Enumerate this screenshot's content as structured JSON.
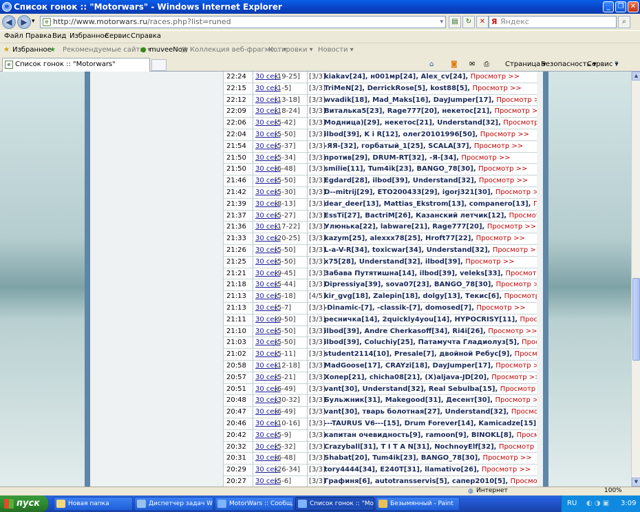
{
  "window": {
    "title": "Список гонок :: \"Motorwars\" - Windows Internet Explorer"
  },
  "address": {
    "url_host": "http://www.motorwars.ru",
    "url_path": "/races.php?list=runed",
    "search_placeholder": "Яндекс",
    "search_logo": "Я"
  },
  "menu": [
    "Файл",
    "Правка",
    "Вид",
    "Избранное",
    "Сервис",
    "Справка"
  ],
  "favbar": {
    "favorites": "Избранное",
    "items": [
      "Рекомендуемые сайты ▾",
      "muveeNow",
      "Коллекция веб-фрагме... ▾",
      "Котировки ▾",
      "Новости ▾"
    ]
  },
  "tab": {
    "label": "Список гонок :: \"Motorwars\""
  },
  "commandbar": [
    "Страница ▾",
    "Безопасность ▾",
    "Сервис ▾"
  ],
  "races": [
    {
      "time": "22:24",
      "link": "30 сек.",
      "pos": "[19-25]",
      "info": "[3/3]",
      "players": "kiakav[24], н001мр[24], Alex_cv[24],",
      "view": "Просмотр >>"
    },
    {
      "time": "22:15",
      "link": "30 сек.",
      "pos": "[1-5]",
      "info": "[3/3]",
      "players": "TriMeN[2], DerrickRose[5], kost88[5],",
      "view": "Просмотр >>"
    },
    {
      "time": "22:12",
      "link": "30 сек.",
      "pos": "[13-18]",
      "info": "[3/3]",
      "players": "wvadik[18], Mad_Maks[16], DayJumper[17],",
      "view": "Просмотр >>"
    },
    {
      "time": "22:09",
      "link": "30 сек.",
      "pos": "[18-24]",
      "info": "[3/3]",
      "players": "Виталька5[23], Rage777[20], некетос[21],",
      "view": "Просмотр >>"
    },
    {
      "time": "22:06",
      "link": "30 сек.",
      "pos": "[5-42]",
      "info": "[3/3]",
      "players": "Модница)[29], некетос[21], Understand[32],",
      "view": "Просмотр >>"
    },
    {
      "time": "22:04",
      "link": "30 сек.",
      "pos": "[5-50]",
      "info": "[3/3]",
      "players": "ilbod[39], K i R[12], олег20101996[50],",
      "view": "Просмотр >>"
    },
    {
      "time": "21:54",
      "link": "30 сек.",
      "pos": "[5-37]",
      "info": "[3/3]",
      "players": "-ЯЯ-[32], горбатый_1[25], SCALA[37],",
      "view": "Просмотр >>"
    },
    {
      "time": "21:50",
      "link": "30 сек.",
      "pos": "[5-34]",
      "info": "[3/3]",
      "players": "против[29], DRUM-RT[32], -Я-[34],",
      "view": "Просмотр >>"
    },
    {
      "time": "21:50",
      "link": "30 сек.",
      "pos": "[6-48]",
      "info": "[3/3]",
      "players": "smilie[11], Tum4ik[23], BANGO_78[30],",
      "view": "Просмотр >>"
    },
    {
      "time": "21:46",
      "link": "30 сек.",
      "pos": "[5-50]",
      "info": "[3/3]",
      "players": "Egdard[28], ilbod[39], Understand[32],",
      "view": "Просмотр >>"
    },
    {
      "time": "21:42",
      "link": "30 сек.",
      "pos": "[5-30]",
      "info": "[3/3]",
      "players": "D--mitrij[29], ETO200433[29], igorj321[30],",
      "view": "Просмотр >>"
    },
    {
      "time": "21:39",
      "link": "30 сек.",
      "pos": "[8-13]",
      "info": "[3/3]",
      "players": "dear_deer[13], Mattias_Ekstrom[13], companero[13],",
      "view": "Просмотр >>"
    },
    {
      "time": "21:37",
      "link": "30 сек.",
      "pos": "[5-27]",
      "info": "[3/3]",
      "players": "EssTi[27], BactriM[26], Казанский летчик[12],",
      "view": "Просмотр >>"
    },
    {
      "time": "21:36",
      "link": "30 сек.",
      "pos": "[17-22]",
      "info": "[3/3]",
      "players": "Улюнька[22], labware[21], Rage777[20],",
      "view": "Просмотр >>"
    },
    {
      "time": "21:33",
      "link": "30 сек.",
      "pos": "[20-25]",
      "info": "[3/3]",
      "players": "kazym[25], alexxx78[25], Hroft77[22],",
      "view": "Просмотр >>"
    },
    {
      "time": "21:26",
      "link": "30 сек.",
      "pos": "[5-50]",
      "info": "[3/3]",
      "players": "L-a-V-R[34], toxicwar[34], Understand[32],",
      "view": "Просмотр >>"
    },
    {
      "time": "21:25",
      "link": "30 сек.",
      "pos": "[5-50]",
      "info": "[3/3]",
      "players": "x75[28], Understand[32], ilbod[39],",
      "view": "Просмотр >>"
    },
    {
      "time": "21:21",
      "link": "30 сек.",
      "pos": "[9-45]",
      "info": "[3/3]",
      "players": "Забава Путятишна[14], ilbod[39], veleks[33],",
      "view": "Просмотр >>"
    },
    {
      "time": "21:18",
      "link": "30 сек.",
      "pos": "[5-44]",
      "info": "[3/3]",
      "players": "Dipressiya[39], sova07[23], BANGO_78[30],",
      "view": "Просмотр >>"
    },
    {
      "time": "21:13",
      "link": "30 сек.",
      "pos": "[5-18]",
      "info": "[4/5]",
      "players": "kir_gvg[18], Zalepin[18], dolgy[13], Текис[6],",
      "view": "Просмотр >>"
    },
    {
      "time": "21:13",
      "link": "30 сек.",
      "pos": "[5-7]",
      "info": "[3/3]",
      "players": "-Dinamic-[7], -classik-[7], domosed[7],",
      "view": "Просмотр >>"
    },
    {
      "time": "21:11",
      "link": "30 сек.",
      "pos": "[9-50]",
      "info": "[3/3]",
      "players": "ресничка[14], 2quickly4you[14], HYPOCRISY[11],",
      "view": "Просмотр >>"
    },
    {
      "time": "21:10",
      "link": "30 сек.",
      "pos": "[5-50]",
      "info": "[3/3]",
      "players": "ilbod[39], Andre Cherkasoff[34], Ri4i[26],",
      "view": "Просмотр >>"
    },
    {
      "time": "21:03",
      "link": "30 сек.",
      "pos": "[5-50]",
      "info": "[3/3]",
      "players": "ilbod[39], Coluchiy[25], Патамучта Гладиолуз[5],",
      "view": "Просмотр >>"
    },
    {
      "time": "21:02",
      "link": "30 сек.",
      "pos": "[5-11]",
      "info": "[3/3]",
      "players": "student2114[10], Presale[7], двойной Ребус[9],",
      "view": "Просмотр >>"
    },
    {
      "time": "20:58",
      "link": "30 сек.",
      "pos": "[12-18]",
      "info": "[3/3]",
      "players": "MadGoose[17], CRAYzi[18], DayJumper[17],",
      "view": "Просмотр >>"
    },
    {
      "time": "20:57",
      "link": "30 сек.",
      "pos": "[5-21]",
      "info": "[3/3]",
      "players": "Хопер[21], chicha08[21], (X)aljava-JD[20],",
      "view": "Просмотр >>"
    },
    {
      "time": "20:51",
      "link": "30 сек.",
      "pos": "[6-49]",
      "info": "[3/3]",
      "players": "vant[30], Understand[32], Real Sebulba[15],",
      "view": "Просмотр >>"
    },
    {
      "time": "20:48",
      "link": "30 сек.",
      "pos": "[30-32]",
      "info": "[3/3]",
      "players": "Бульжник[31], Makegood[31], Десент[30],",
      "view": "Просмотр >>"
    },
    {
      "time": "20:47",
      "link": "30 сек.",
      "pos": "[6-49]",
      "info": "[3/3]",
      "players": "vant[30], тварь болотная[27], Understand[32],",
      "view": "Просмотр >>"
    },
    {
      "time": "20:46",
      "link": "30 сек.",
      "pos": "[10-16]",
      "info": "[3/3]",
      "players": "---TAURUS V6---[15], Drum Forever[14], Kamicadze[15],",
      "view": "Просмотр >>"
    },
    {
      "time": "20:42",
      "link": "30 сек.",
      "pos": "[5-9]",
      "info": "[3/3]",
      "players": "капитан очевидность[9], ramoon[9], BINOKL[8],",
      "view": "Просмотр >>"
    },
    {
      "time": "20:32",
      "link": "30 сек.",
      "pos": "[5-32]",
      "info": "[3/3]",
      "players": "Crazyball[31], T I T A N[31], NochnoyElf[32],",
      "view": "Просмотр >>"
    },
    {
      "time": "20:31",
      "link": "30 сек.",
      "pos": "[6-48]",
      "info": "[3/3]",
      "players": "Shabat[20], Tum4ik[23], BANGO_78[30],",
      "view": "Просмотр >>"
    },
    {
      "time": "20:29",
      "link": "30 сек.",
      "pos": "[26-34]",
      "info": "[3/3]",
      "players": "tory4444[34], E240T[31], llamativo[26],",
      "view": "Просмотр >>"
    },
    {
      "time": "20:27",
      "link": "30 сек.",
      "pos": "[5-6]",
      "info": "[3/3]",
      "players": "Графиня[6], autotransservis[5], сапер2010[5],",
      "view": "Просмотр >>"
    }
  ],
  "status": {
    "zone": "Интернет",
    "zoom": "100%"
  },
  "taskbar": {
    "start": "пуск",
    "tasks": [
      "Новая папка",
      "Диспетчер задач Wi...",
      "MotorWars :: Сообщ...",
      "Список гонок :: \"Mot...",
      "Безымянный - Paint"
    ],
    "lang": "RU",
    "clock": "3:09"
  },
  "colors": {
    "title_bar": "#0842c4",
    "page_frame": "#5e86a6",
    "view_link": "#c00000",
    "name": "#1a2a5a"
  }
}
